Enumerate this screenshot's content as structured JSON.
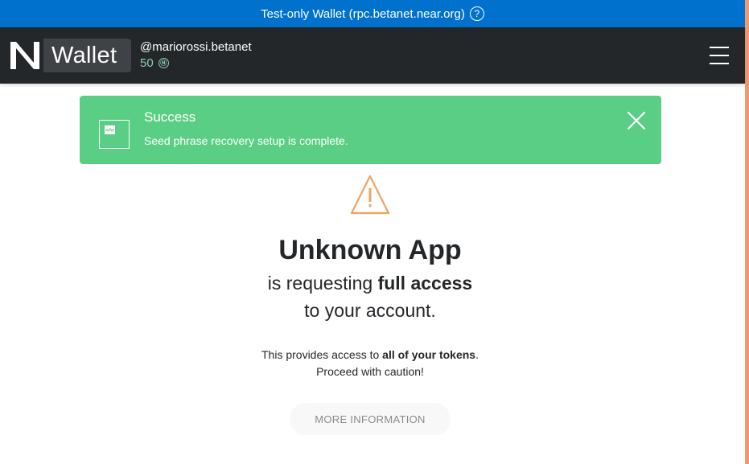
{
  "test_banner": {
    "text": "Test-only Wallet (rpc.betanet.near.org)",
    "help_glyph": "?"
  },
  "navbar": {
    "logo_text": "Wallet",
    "account_name": "@mariorossi.betanet",
    "balance": "50",
    "near_glyph": "Ⓝ"
  },
  "alert": {
    "title": "Success",
    "message": "Seed phrase recovery setup is complete."
  },
  "main": {
    "title": "Unknown App",
    "subtitle_prefix": "is requesting ",
    "subtitle_bold": "full access",
    "subtitle_line2": "to your account.",
    "desc_prefix": "This provides access to ",
    "desc_bold": "all of your tokens",
    "desc_suffix": ".",
    "desc_line2": "Proceed with caution!",
    "more_info_label": "MORE INFORMATION"
  },
  "colors": {
    "banner": "#0072ce",
    "navbar": "#24272a",
    "success": "#5ace84",
    "warning": "#f0a35e",
    "balance": "#8fcdb0"
  },
  "icons": [
    "help-icon",
    "near-logo-icon",
    "near-token-icon",
    "menu-icon",
    "alert-image-icon",
    "close-icon",
    "warning-icon"
  ]
}
